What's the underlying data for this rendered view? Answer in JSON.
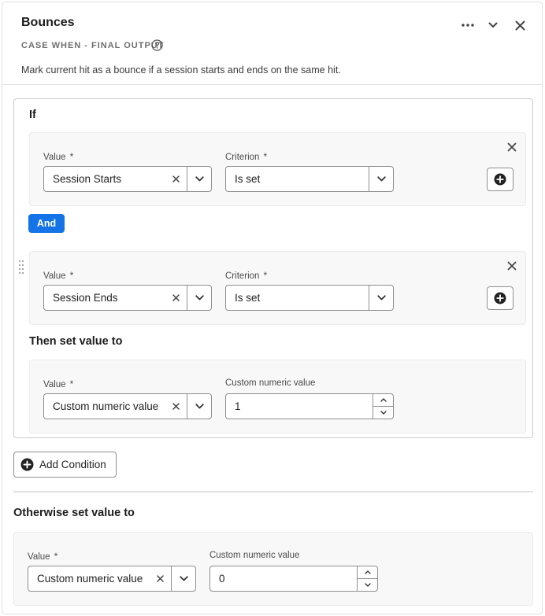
{
  "header": {
    "title": "Bounces",
    "subtitle": "CASE WHEN - FINAL OUTPUT",
    "description": "Mark current hit as a bounce if a session starts and ends on the same hit."
  },
  "if_section": {
    "title": "If",
    "conditions": [
      {
        "value_label": "Value",
        "value": "Session Starts",
        "criterion_label": "Criterion",
        "criterion": "Is set"
      },
      {
        "value_label": "Value",
        "value": "Session Ends",
        "criterion_label": "Criterion",
        "criterion": "Is set"
      }
    ],
    "operator": "And",
    "then": {
      "title": "Then set value to",
      "value_label": "Value",
      "value": "Custom numeric value",
      "custom_label": "Custom numeric value",
      "custom_value": "1"
    }
  },
  "add_condition_label": "Add Condition",
  "otherwise": {
    "title": "Otherwise set value to",
    "value_label": "Value",
    "value": "Custom numeric value",
    "custom_label": "Custom numeric value",
    "custom_value": "0"
  },
  "required_marker": "*",
  "colors": {
    "accent": "#1473e6",
    "card_bg": "#f8f8f8",
    "border": "#8e8e8e"
  }
}
